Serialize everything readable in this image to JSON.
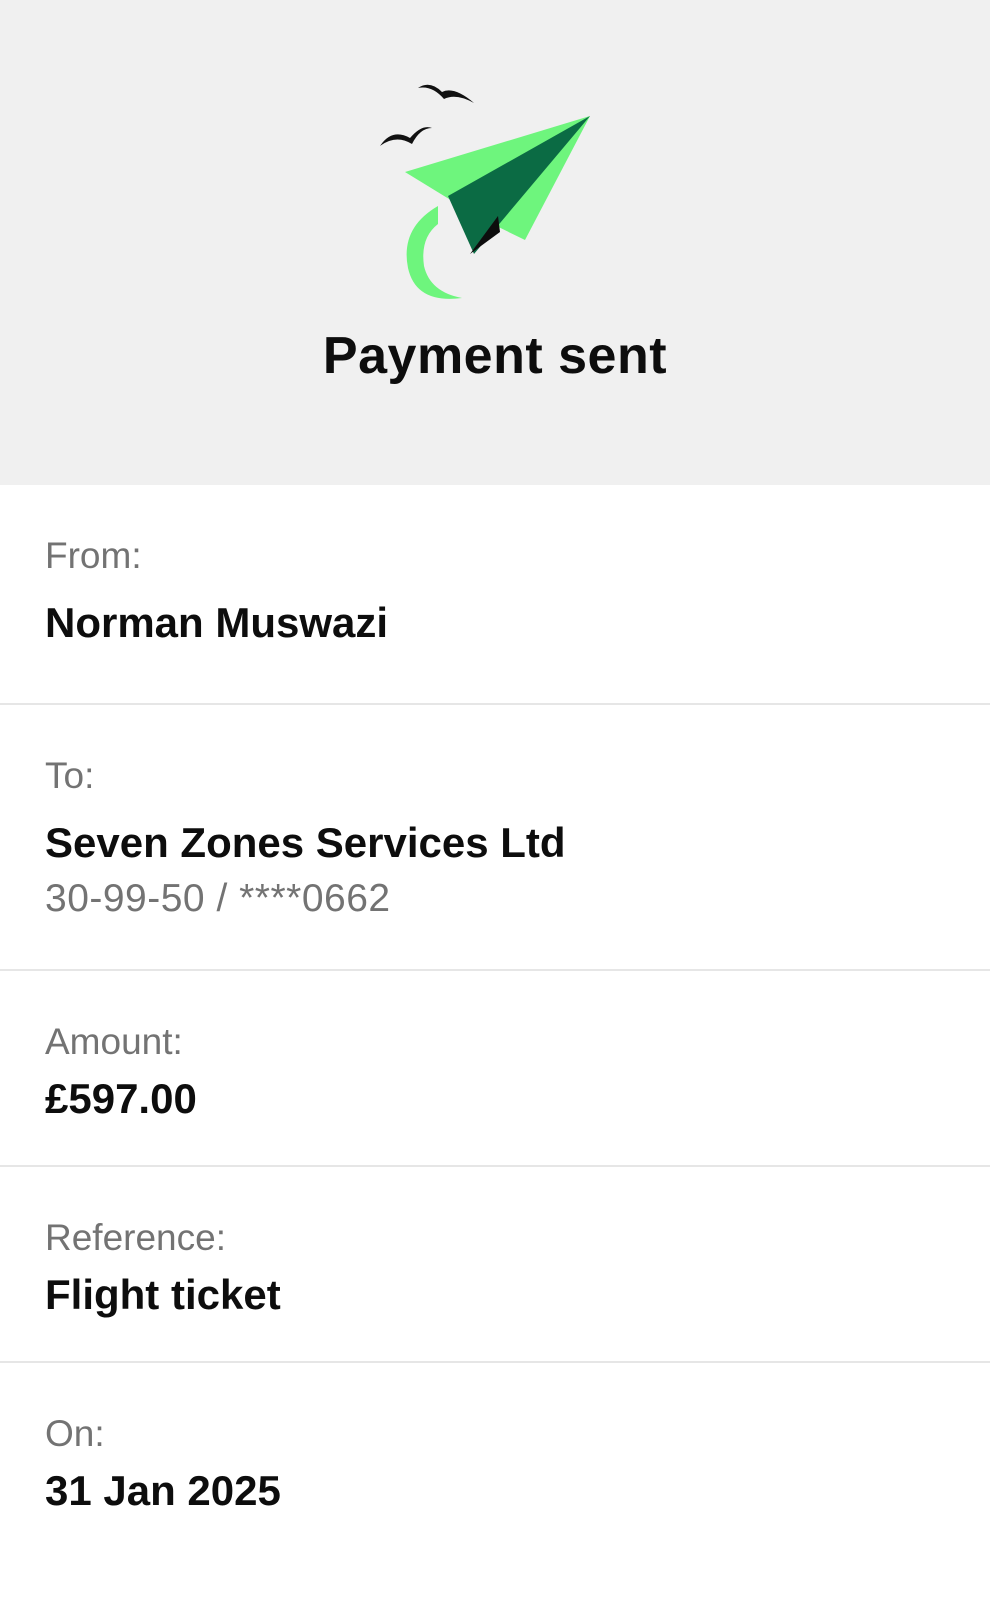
{
  "header": {
    "title": "Payment sent",
    "illustration_icon": "paper-plane-with-birds-icon",
    "colors": {
      "plane_light": "#6ef57d",
      "plane_dark": "#0b6b44",
      "background": "#f0f0f0"
    }
  },
  "details": {
    "from": {
      "label": "From:",
      "value": "Norman Muswazi"
    },
    "to": {
      "label": "To:",
      "value": "Seven Zones Services Ltd",
      "account": "30-99-50 / ****0662"
    },
    "amount": {
      "label": "Amount:",
      "value": "£597.00"
    },
    "reference": {
      "label": "Reference:",
      "value": "Flight ticket"
    },
    "date": {
      "label": "On:",
      "value": "31 Jan 2025"
    }
  }
}
